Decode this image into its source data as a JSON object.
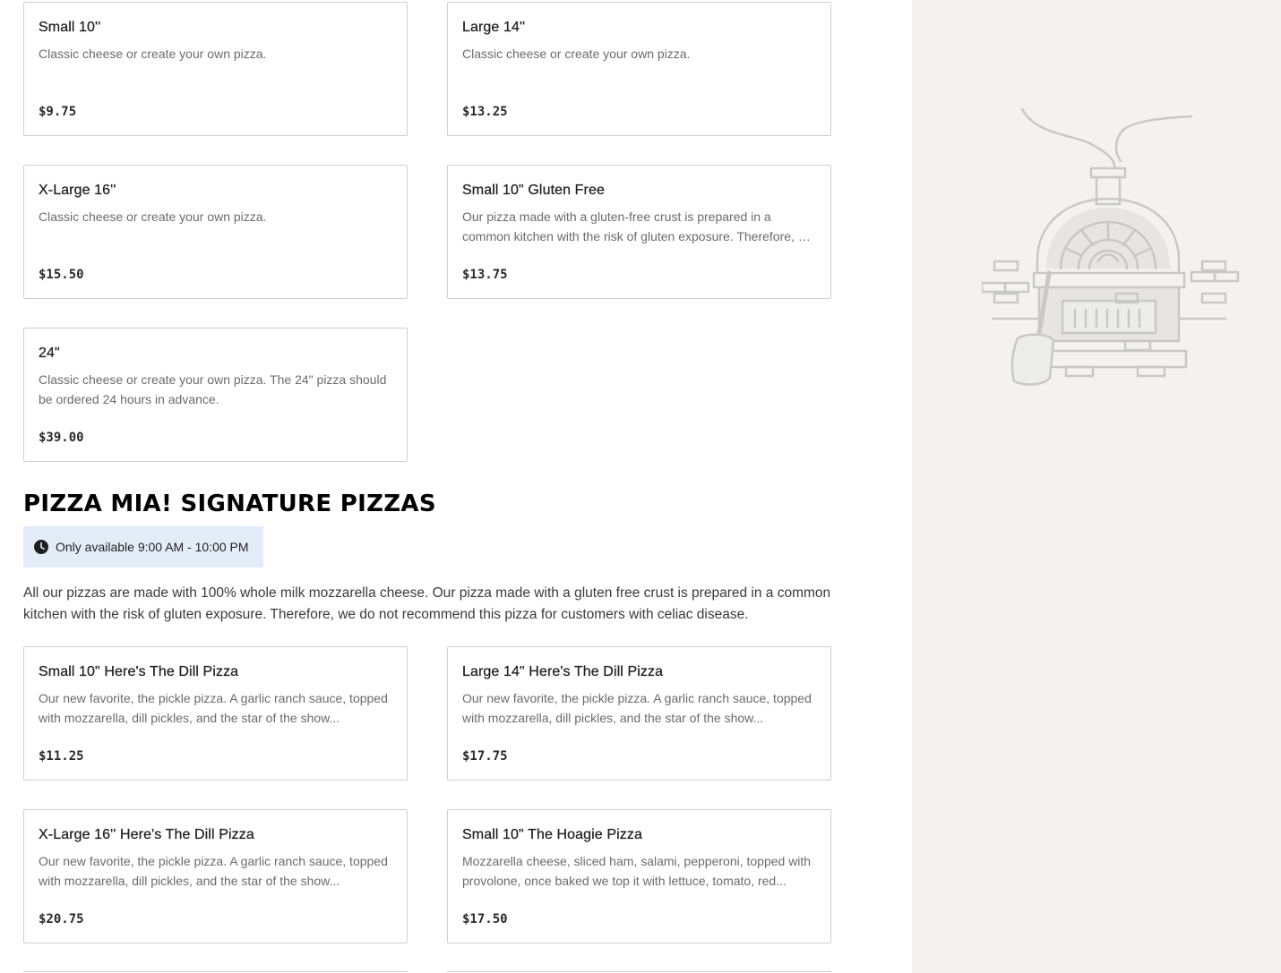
{
  "items_top": [
    {
      "name": "Small 10''",
      "desc": "Classic cheese or create your own pizza.",
      "price": "$9.75"
    },
    {
      "name": "Large 14''",
      "desc": "Classic cheese or create your own pizza.",
      "price": "$13.25"
    },
    {
      "name": "X-Large 16''",
      "desc": "Classic cheese or create your own pizza.",
      "price": "$15.50"
    },
    {
      "name": "Small 10\" Gluten Free",
      "desc": "Our pizza made with a gluten-free crust is prepared in a common kitchen with the risk of gluten exposure. Therefore, we do not recommend this pizza for customers with celiac disease.",
      "price": "$13.75"
    },
    {
      "name": "24\"",
      "desc": "Classic cheese or create your own pizza. The 24\" pizza should be ordered 24 hours in advance.",
      "price": "$39.00"
    }
  ],
  "signature": {
    "title": "PIZZA MIA! SIGNATURE PIZZAS",
    "availability": "Only available 9:00 AM - 10:00 PM",
    "description": "All our pizzas are made with 100% whole milk mozzarella cheese. Our pizza made with a gluten free crust is prepared in a common kitchen with the risk of gluten exposure. Therefore, we do not recommend this pizza for customers with celiac disease.",
    "items": [
      {
        "name": "Small 10\" Here's The Dill Pizza",
        "desc": "Our new favorite, the pickle pizza. A garlic ranch sauce, topped with mozzarella, dill pickles, and the star of the show...",
        "price": "$11.25"
      },
      {
        "name": "Large 14\" Here's The Dill Pizza",
        "desc": "Our new favorite, the pickle pizza. A garlic ranch sauce, topped with mozzarella, dill pickles, and the star of the show...",
        "price": "$17.75"
      },
      {
        "name": "X-Large 16'' Here's The Dill Pizza",
        "desc": "Our new favorite, the pickle pizza. A garlic ranch sauce, topped with mozzarella, dill pickles, and the star of the show...",
        "price": "$20.75"
      },
      {
        "name": "Small 10\" The Hoagie Pizza",
        "desc": "Mozzarella cheese, sliced ham, salami, pepperoni, topped with provolone, once baked we top it with lettuce, tomato, red...",
        "price": "$17.50"
      }
    ]
  },
  "sidebar": {
    "illustration": "pizza-oven-illustration"
  },
  "icons": {
    "clock": "clock-icon"
  }
}
